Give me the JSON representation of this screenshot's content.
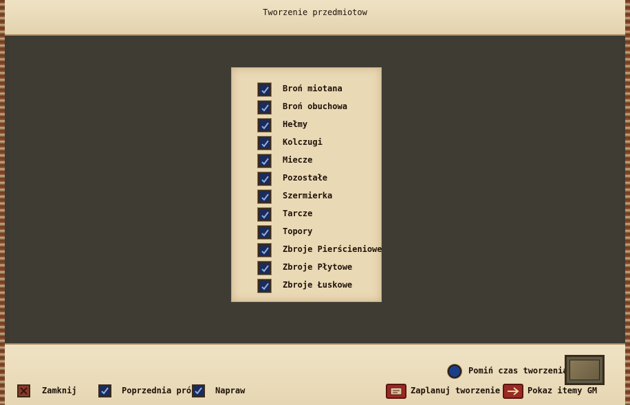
{
  "window": {
    "title": "Tworzenie przedmiotow"
  },
  "categories": [
    {
      "label": "Broń miotana",
      "checked": true
    },
    {
      "label": "Broń obuchowa",
      "checked": true
    },
    {
      "label": "Hełmy",
      "checked": true
    },
    {
      "label": "Kolczugi",
      "checked": true
    },
    {
      "label": "Miecze",
      "checked": true
    },
    {
      "label": "Pozostałe",
      "checked": true
    },
    {
      "label": "Szermierka",
      "checked": true
    },
    {
      "label": "Tarcze",
      "checked": true
    },
    {
      "label": "Topory",
      "checked": true
    },
    {
      "label": "Zbroje Pierścieniowe",
      "checked": true
    },
    {
      "label": "Zbroje Płytowe",
      "checked": true
    },
    {
      "label": "Zbroje Łuskowe",
      "checked": true
    }
  ],
  "footer": {
    "close_label": "Zamknij",
    "previous_label": "Poprzednia próba",
    "repair_label": "Napraw",
    "skip_time_label": "Pomiń czas tworzenia",
    "schedule_label": "Zaplanuj tworzenie",
    "show_gm_label": "Pokaz itemy GM"
  },
  "colors": {
    "parchment": "#ead9b5",
    "panel": "#3f3c34",
    "checkbox": "#1b2c5a",
    "accent_red": "#9a2a22"
  }
}
